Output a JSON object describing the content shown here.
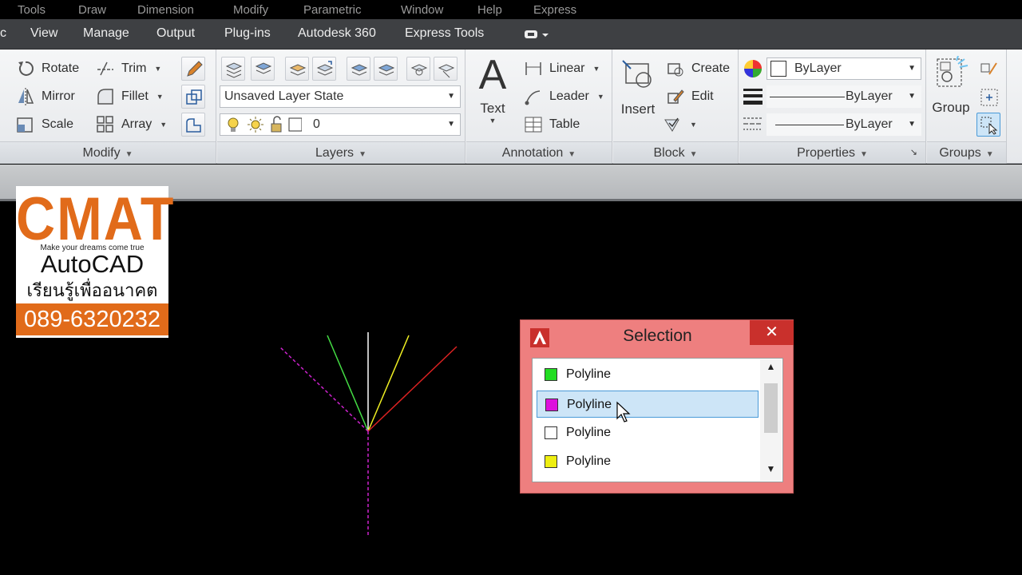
{
  "top_strip": [
    "Tools",
    "Draw",
    "Dimension",
    "Modify",
    "Parametric",
    "Window",
    "Help",
    "Express"
  ],
  "tabs": [
    "c",
    "View",
    "Manage",
    "Output",
    "Plug-ins",
    "Autodesk 360",
    "Express Tools"
  ],
  "modify": {
    "title": "Modify",
    "rotate": "Rotate",
    "mirror": "Mirror",
    "scale": "Scale",
    "trim": "Trim",
    "fillet": "Fillet",
    "array": "Array"
  },
  "layers": {
    "title": "Layers",
    "layer_state": "Unsaved Layer State",
    "current_layer": "0"
  },
  "annotation": {
    "title": "Annotation",
    "text": "Text",
    "linear": "Linear",
    "leader": "Leader",
    "table": "Table"
  },
  "block": {
    "title": "Block",
    "insert": "Insert",
    "create": "Create",
    "edit": "Edit"
  },
  "properties": {
    "title": "Properties",
    "color": "ByLayer",
    "lineweight": "ByLayer",
    "linetype": "ByLayer"
  },
  "groups": {
    "title": "Groups",
    "group": "Group"
  },
  "logo": {
    "brand": "CMAT",
    "tagline": "Make your dreams come true",
    "product": "AutoCAD",
    "thai": "เรียนรู้เพื่ออนาคต",
    "phone": "089-6320232",
    "accent": "#e16b1a"
  },
  "dialog": {
    "title": "Selection",
    "close": "✕",
    "items": [
      {
        "label": "Polyline",
        "color": "#22dd22",
        "selected": false
      },
      {
        "label": "Polyline",
        "color": "#dd11dd",
        "selected": true
      },
      {
        "label": "Polyline",
        "color": "#ffffff",
        "selected": false
      },
      {
        "label": "Polyline",
        "color": "#eeee11",
        "selected": false
      }
    ]
  }
}
